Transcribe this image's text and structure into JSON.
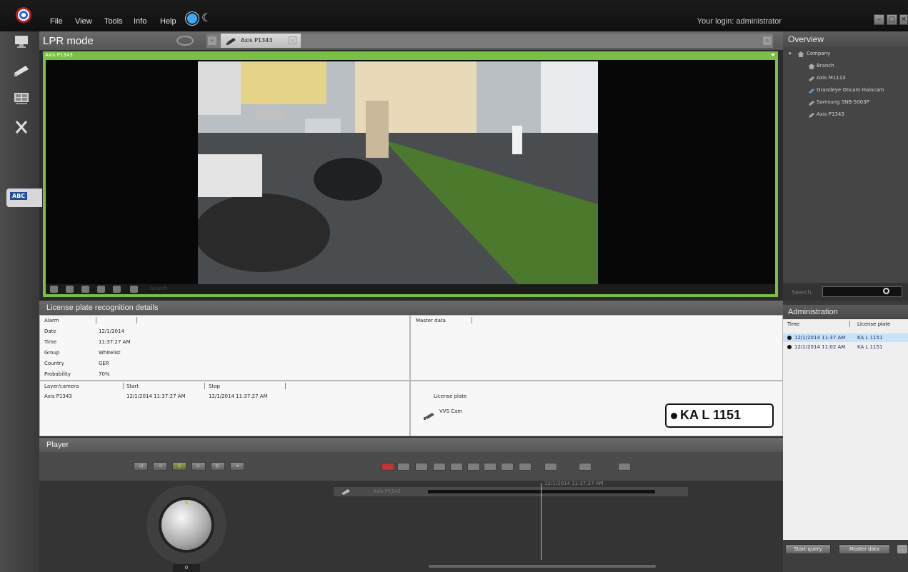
{
  "menu": {
    "file": "File",
    "view": "View",
    "tools": "Tools",
    "info": "Info",
    "help": "Help"
  },
  "login": "Your login: administrator",
  "view": {
    "title": "LPR mode",
    "tab_label": "Axis P1343"
  },
  "left_rail": {
    "lpr_badge": "ABC"
  },
  "camera": {
    "title": "Axis P1343",
    "search_placeholder": "Search"
  },
  "details": {
    "title": "License plate recognition details",
    "alarm_header": "Alarm",
    "fields": [
      {
        "label": "Date",
        "value": "12/1/2014"
      },
      {
        "label": "Time",
        "value": "11:37:27 AM"
      },
      {
        "label": "Group",
        "value": "Whitelist"
      },
      {
        "label": "Country",
        "value": "GER"
      },
      {
        "label": "Probability",
        "value": "70%"
      }
    ],
    "master_data_header": "Master data",
    "layer_headers": {
      "layer": "Layer/camera",
      "start": "Start",
      "stop": "Stop"
    },
    "layer_row": {
      "layer": "Axis P1343",
      "start": "12/1/2014 11:37:27 AM",
      "stop": "12/1/2014 11:37:27 AM"
    },
    "plate_section_label": "License plate",
    "plate_source_camera": "VVS Cam",
    "plate": "KA L 1151"
  },
  "player": {
    "title": "Player",
    "speed": "0",
    "track_camera": "Axis P1343",
    "cursor_time": "12/1/2014 11:37:27 AM"
  },
  "overview": {
    "title": "Overview",
    "tree": [
      {
        "label": "Company"
      },
      {
        "label": "Branch"
      },
      {
        "label": "Axis M1113"
      },
      {
        "label": "Grandeye Oncam Halocam"
      },
      {
        "label": "Samsung SNB-5003P"
      },
      {
        "label": "Axis P1343"
      }
    ]
  },
  "search": {
    "label": "Search:",
    "value": ""
  },
  "administration": {
    "title": "Administration",
    "columns": [
      "Time",
      "License plate"
    ],
    "rows": [
      {
        "time": "12/1/2014 11:37 AM",
        "plate": "KA L 1151"
      },
      {
        "time": "12/1/2014 11:02 AM",
        "plate": "KA L 1151"
      }
    ],
    "start_query": "Start query",
    "master_data": "Master data"
  },
  "colors": {
    "accent_green": "#7ac142",
    "selection_blue": "#c7e2fa",
    "plate_badge_blue": "#1d4ea1"
  }
}
